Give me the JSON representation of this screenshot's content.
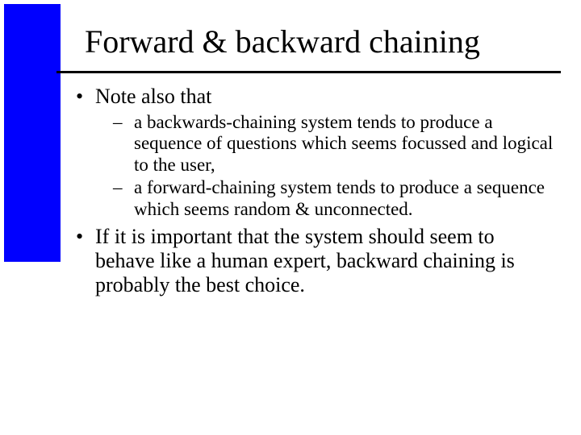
{
  "title": "Forward & backward chaining",
  "bullets": {
    "b1": "Note also that",
    "b1_subs": {
      "s1": "a backwards-chaining system tends to produce a sequence of questions which seems focussed and logical to the user,",
      "s2": "a forward-chaining system tends to produce a sequence which seems random & unconnected."
    },
    "b2": "If it is important that the system should seem to behave like a human expert, backward chaining is probably the best choice."
  }
}
